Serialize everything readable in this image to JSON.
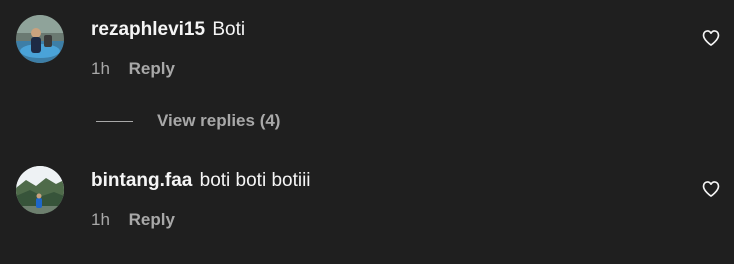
{
  "comments": [
    {
      "username": "rezaphlevi15",
      "text": "Boti",
      "time": "1h",
      "reply_label": "Reply",
      "avatar_icon": "user-avatar-photo-blue"
    },
    {
      "username": "bintang.faa",
      "text": "boti boti botiii",
      "time": "1h",
      "reply_label": "Reply",
      "avatar_icon": "user-avatar-photo-landscape"
    }
  ],
  "view_replies": {
    "label": "View replies (4)"
  },
  "icons": {
    "like": "heart-outline-icon"
  },
  "colors": {
    "background": "#1f1f1f",
    "primary_text": "#f5f5f5",
    "secondary_text": "#a8a8a8"
  }
}
